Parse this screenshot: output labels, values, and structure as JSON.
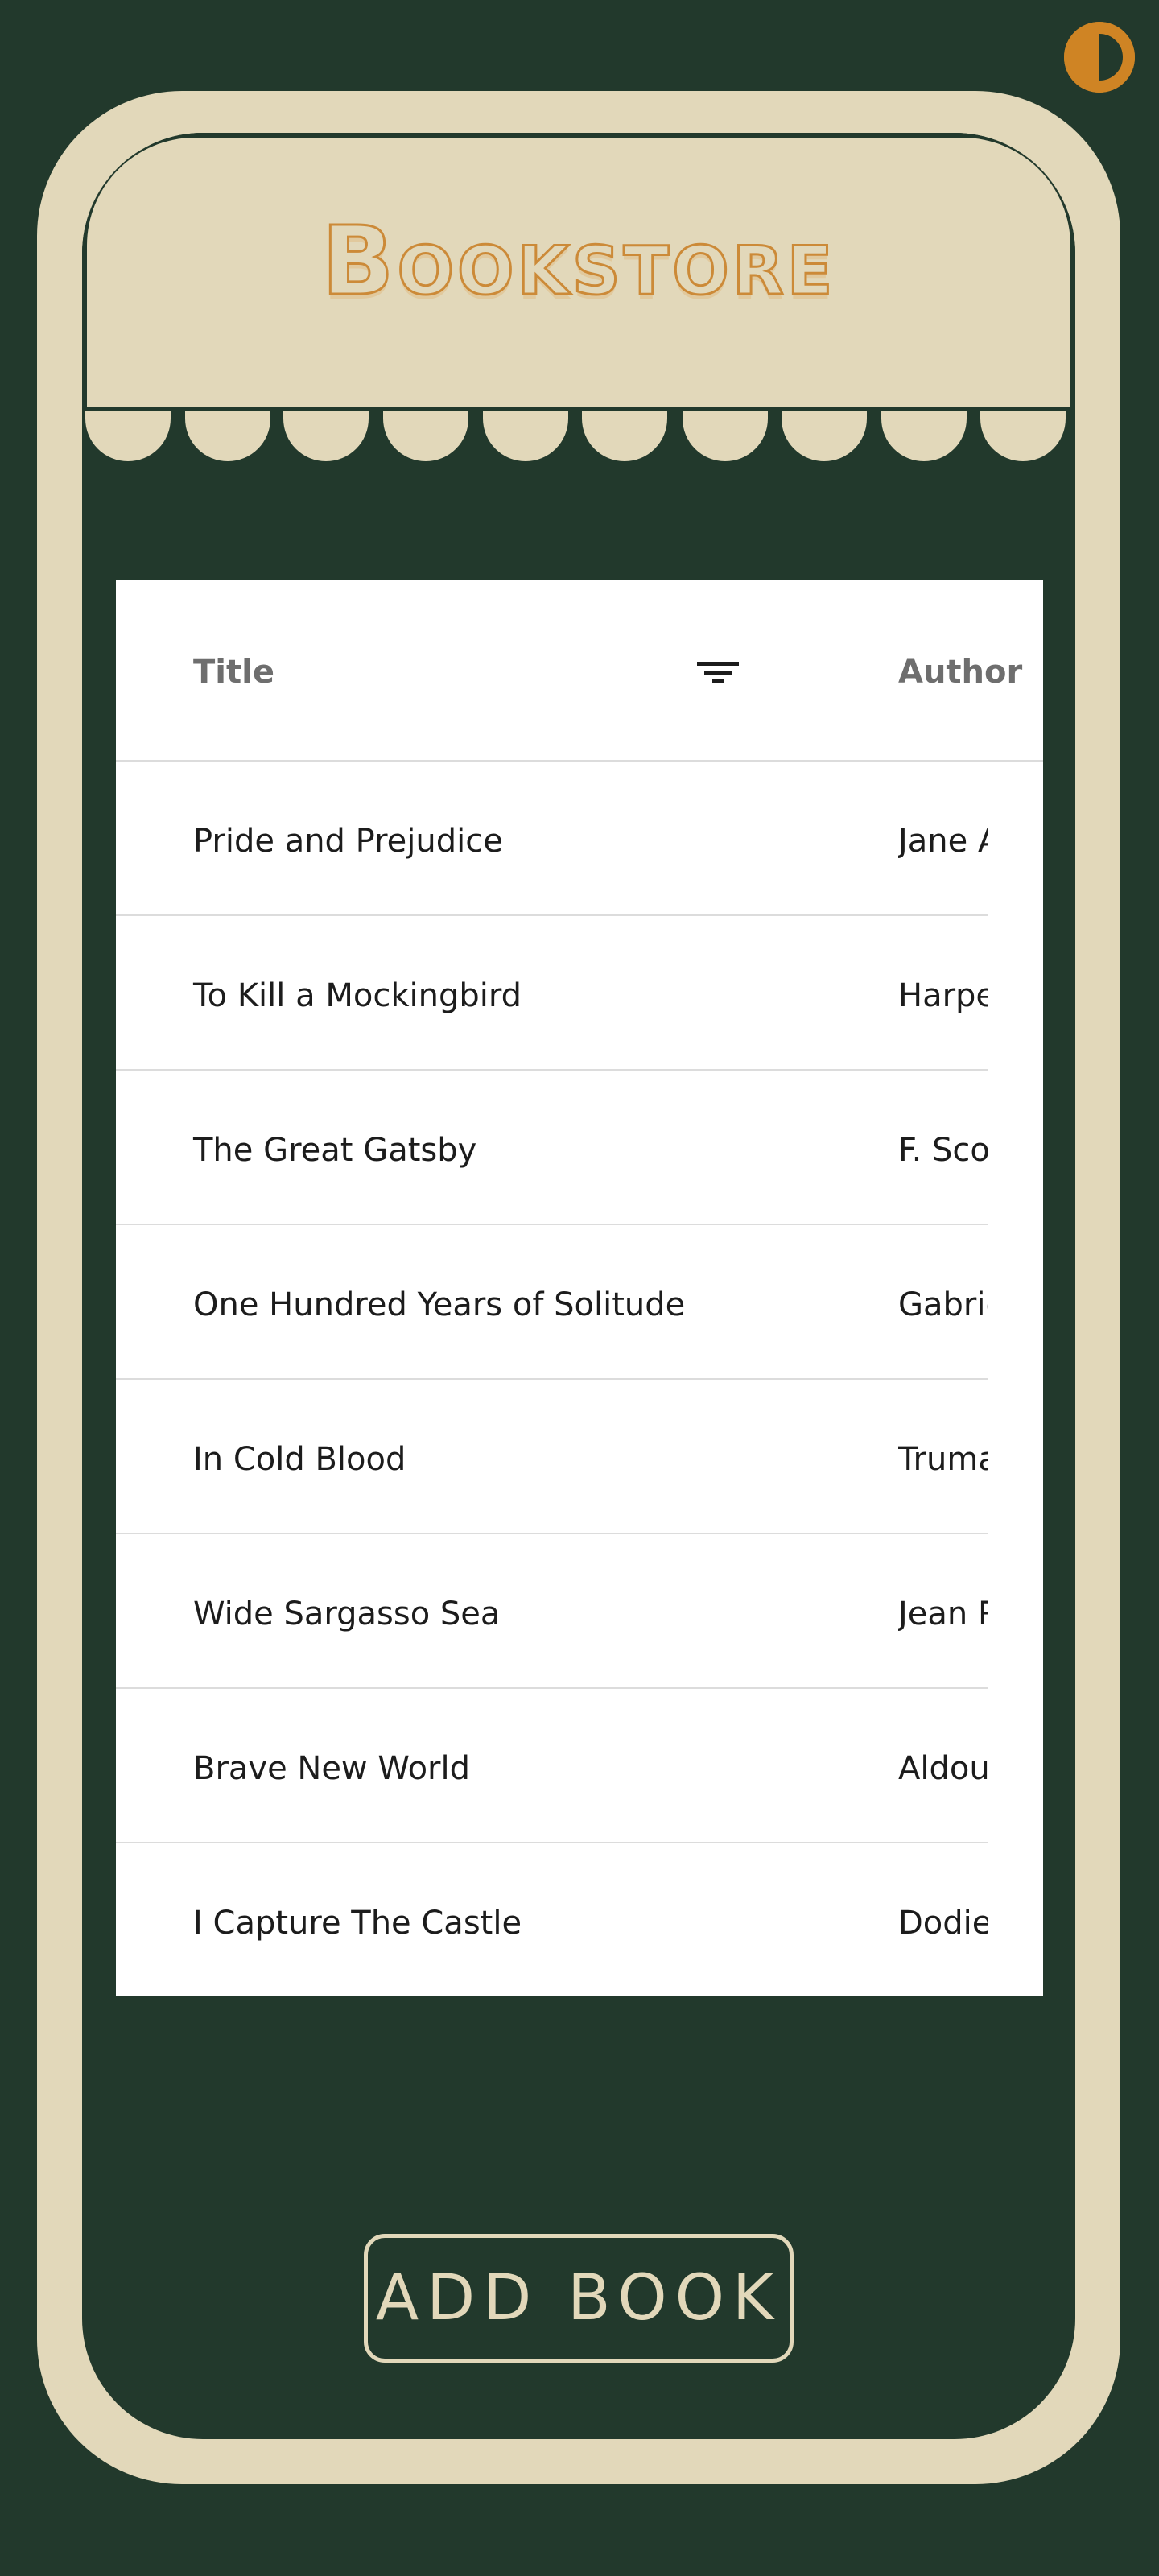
{
  "header": {
    "logo_text": "Bookstore"
  },
  "table": {
    "columns": [
      "Title",
      "Author"
    ],
    "rows": [
      {
        "title": "Pride and Prejudice",
        "author": "Jane A"
      },
      {
        "title": "To Kill a Mockingbird",
        "author": "Harpe"
      },
      {
        "title": "The Great Gatsby",
        "author": "F. Sco"
      },
      {
        "title": "One Hundred Years of Solitude",
        "author": "Gabrie"
      },
      {
        "title": "In Cold Blood",
        "author": "Truma"
      },
      {
        "title": "Wide Sargasso Sea",
        "author": "Jean R"
      },
      {
        "title": "Brave New World",
        "author": "Aldou"
      },
      {
        "title": "I Capture The Castle",
        "author": "Dodie"
      }
    ]
  },
  "actions": {
    "add_book_label": "ADD BOOK"
  },
  "icons": {
    "theme_toggle": "contrast-icon",
    "filter": "filter-icon"
  },
  "colors": {
    "background": "#22392c",
    "cream": "#e2d8ba",
    "accent": "#cf8424"
  }
}
